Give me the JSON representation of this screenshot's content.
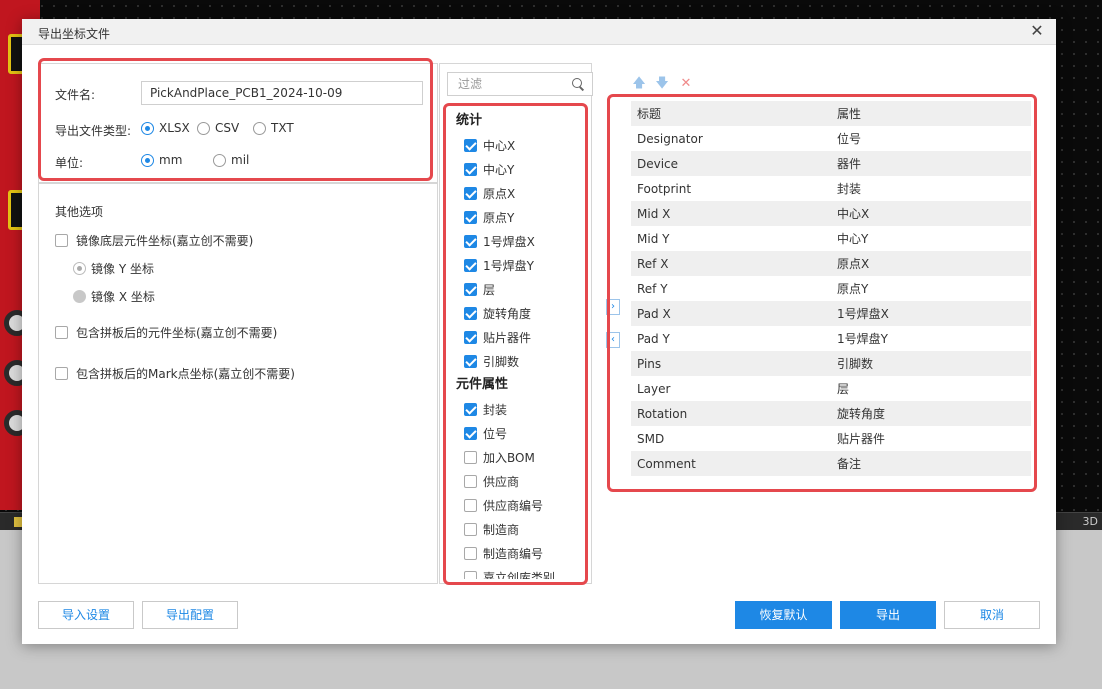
{
  "background": {
    "statusbar_right_label": "3D"
  },
  "dialog": {
    "title": "导出坐标文件"
  },
  "left": {
    "filename_label": "文件名:",
    "filename_value": "PickAndPlace_PCB1_2024-10-09",
    "filetype_label": "导出文件类型:",
    "filetypes": [
      {
        "label": "XLSX",
        "selected": true
      },
      {
        "label": "CSV",
        "selected": false
      },
      {
        "label": "TXT",
        "selected": false
      }
    ],
    "unit_label": "单位:",
    "units": [
      {
        "label": "mm",
        "selected": true
      },
      {
        "label": "mil",
        "selected": false
      }
    ],
    "other_options_title": "其他选项",
    "options": [
      {
        "label": "镜像底层元件坐标(嘉立创不需要)",
        "checked": false
      },
      {
        "label": "包含拼板后的元件坐标(嘉立创不需要)",
        "checked": false
      },
      {
        "label": "包含拼板后的Mark点坐标(嘉立创不需要)",
        "checked": false
      }
    ],
    "mirror_y_label": "镜像 Y 坐标",
    "mirror_x_label": "镜像 X 坐标"
  },
  "middle": {
    "filter_placeholder": "过滤",
    "groups": [
      {
        "title": "统计",
        "items": [
          {
            "label": "中心X",
            "checked": true
          },
          {
            "label": "中心Y",
            "checked": true
          },
          {
            "label": "原点X",
            "checked": true
          },
          {
            "label": "原点Y",
            "checked": true
          },
          {
            "label": "1号焊盘X",
            "checked": true
          },
          {
            "label": "1号焊盘Y",
            "checked": true
          },
          {
            "label": "层",
            "checked": true
          },
          {
            "label": "旋转角度",
            "checked": true
          },
          {
            "label": "贴片器件",
            "checked": true
          },
          {
            "label": "引脚数",
            "checked": true
          }
        ]
      },
      {
        "title": "元件属性",
        "items": [
          {
            "label": "封装",
            "checked": true
          },
          {
            "label": "位号",
            "checked": true
          },
          {
            "label": "加入BOM",
            "checked": false
          },
          {
            "label": "供应商",
            "checked": false
          },
          {
            "label": "供应商编号",
            "checked": false
          },
          {
            "label": "制造商",
            "checked": false
          },
          {
            "label": "制造商编号",
            "checked": false
          },
          {
            "label": "嘉立创库类别",
            "checked": false
          }
        ]
      }
    ]
  },
  "transfer": {
    "add_glyph": "›",
    "remove_glyph": "‹"
  },
  "right": {
    "toolbar": {
      "up_glyph": "🡅",
      "down_glyph": "🡇",
      "delete_glyph": "✕"
    },
    "header": {
      "c1": "标题",
      "c2": "属性"
    },
    "rows": [
      {
        "c1": "Designator",
        "c2": "位号"
      },
      {
        "c1": "Device",
        "c2": "器件"
      },
      {
        "c1": "Footprint",
        "c2": "封装"
      },
      {
        "c1": "Mid X",
        "c2": "中心X"
      },
      {
        "c1": "Mid Y",
        "c2": "中心Y"
      },
      {
        "c1": "Ref X",
        "c2": "原点X"
      },
      {
        "c1": "Ref Y",
        "c2": "原点Y"
      },
      {
        "c1": "Pad X",
        "c2": "1号焊盘X"
      },
      {
        "c1": "Pad Y",
        "c2": "1号焊盘Y"
      },
      {
        "c1": "Pins",
        "c2": "引脚数"
      },
      {
        "c1": "Layer",
        "c2": "层"
      },
      {
        "c1": "Rotation",
        "c2": "旋转角度"
      },
      {
        "c1": "SMD",
        "c2": "贴片器件"
      },
      {
        "c1": "Comment",
        "c2": "备注"
      }
    ]
  },
  "footer": {
    "import_settings": "导入设置",
    "export_config": "导出配置",
    "restore_default": "恢复默认",
    "export": "导出",
    "cancel": "取消"
  },
  "colors": {
    "accent": "#1e88e5",
    "highlight_border": "#e5484d"
  }
}
